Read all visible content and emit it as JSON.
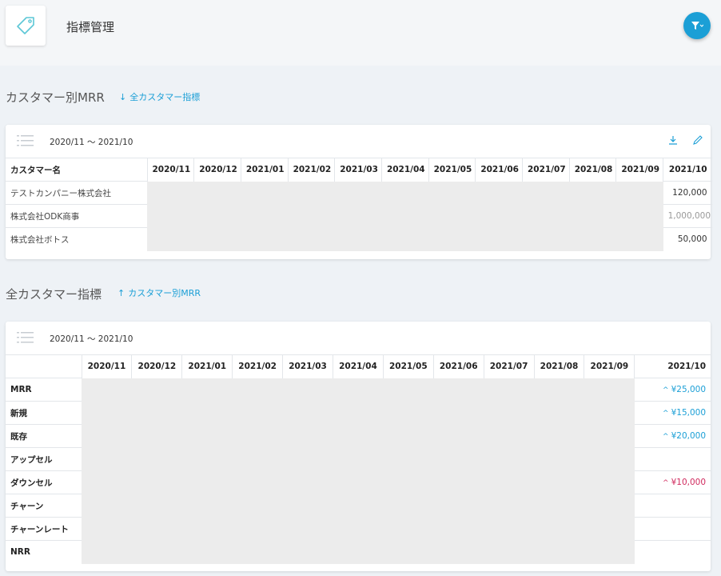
{
  "header": {
    "title": "指標管理",
    "tag_icon": "tag-icon",
    "filter_icon": "filter-icon"
  },
  "section1": {
    "title": "カスタマー別MRR",
    "link": "全カスタマー指標",
    "period": "2020/11 ～ 2021/10",
    "columns": [
      "カスタマー名",
      "2020/11",
      "2020/12",
      "2021/01",
      "2021/02",
      "2021/03",
      "2021/04",
      "2021/05",
      "2021/06",
      "2021/07",
      "2021/08",
      "2021/09",
      "2021/10"
    ],
    "rows": [
      {
        "name": "テストカンパニー株式会社",
        "value": "120,000"
      },
      {
        "name": "株式会社ODK商事",
        "value": "1,000,000"
      },
      {
        "name": "株式会社ボトス",
        "value": "50,000"
      }
    ]
  },
  "section2": {
    "title": "全カスタマー指標",
    "link": "カスタマー別MRR",
    "period": "2020/11 ～ 2021/10",
    "columns": [
      "",
      "2020/11",
      "2020/12",
      "2021/01",
      "2021/02",
      "2021/03",
      "2021/04",
      "2021/05",
      "2021/06",
      "2021/07",
      "2021/08",
      "2021/09",
      "2021/10"
    ],
    "rows": [
      {
        "name": "MRR",
        "value": "¥25,000",
        "trend": "up"
      },
      {
        "name": "新規",
        "value": "¥15,000",
        "trend": "up"
      },
      {
        "name": "既存",
        "value": "¥20,000",
        "trend": "up"
      },
      {
        "name": "アップセル",
        "value": "",
        "trend": ""
      },
      {
        "name": "ダウンセル",
        "value": "¥10,000",
        "trend": "down"
      },
      {
        "name": "チャーン",
        "value": "",
        "trend": ""
      },
      {
        "name": "チャーンレート",
        "value": "",
        "trend": ""
      },
      {
        "name": "NRR",
        "value": "",
        "trend": ""
      }
    ]
  },
  "colors": {
    "accent": "#1b9fd6",
    "down": "#d02a5e"
  }
}
